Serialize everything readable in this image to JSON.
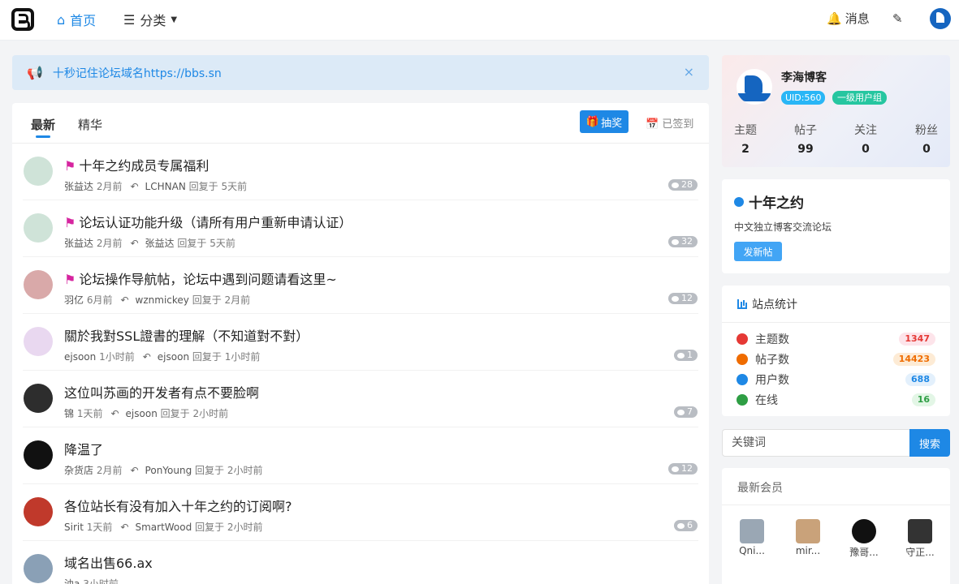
{
  "nav": {
    "home_label": "首页",
    "category_label": "分类",
    "messages_label": "消息"
  },
  "notice": {
    "text": "十秒记住论坛域名https://bbs.sn",
    "close": "×"
  },
  "tabs": {
    "latest": "最新",
    "featured": "精华",
    "lottery_button": "抽奖",
    "checkin_label": "已签到"
  },
  "posts": [
    {
      "flag": true,
      "title": "十年之约成员专属福利",
      "author": "张益达",
      "time": "2月前",
      "last_replier": "LCHNAN",
      "reply_time": "回复于 5天前",
      "count": "28"
    },
    {
      "flag": true,
      "title": "论坛认证功能升级（请所有用户重新申请认证）",
      "author": "张益达",
      "time": "2月前",
      "last_replier": "张益达",
      "reply_time": "回复于 5天前",
      "count": "32"
    },
    {
      "flag": true,
      "title": "论坛操作导航帖，论坛中遇到问题请看这里~",
      "author": "羽亿",
      "time": "6月前",
      "last_replier": "wznmickey",
      "reply_time": "回复于 2月前",
      "count": "12"
    },
    {
      "flag": false,
      "title": "關於我對SSL證書的理解（不知道對不對）",
      "author": "ejsoon",
      "time": "1小时前",
      "last_replier": "ejsoon",
      "reply_time": "回复于 1小时前",
      "count": "1"
    },
    {
      "flag": false,
      "title": "这位叫苏画的开发者有点不要脸啊",
      "author": "锦",
      "time": "1天前",
      "last_replier": "ejsoon",
      "reply_time": "回复于 2小时前",
      "count": "7"
    },
    {
      "flag": false,
      "title": "降温了",
      "author": "杂货店",
      "time": "2月前",
      "last_replier": "PonYoung",
      "reply_time": "回复于 2小时前",
      "count": "12"
    },
    {
      "flag": false,
      "title": "各位站长有没有加入十年之约的订阅啊?",
      "author": "Sirit",
      "time": "1天前",
      "last_replier": "SmartWood",
      "reply_time": "回复于 2小时前",
      "count": "6"
    },
    {
      "flag": false,
      "title": "域名出售66.ax",
      "author": "油a",
      "time": "3小时前",
      "last_replier": "",
      "reply_time": "",
      "count": ""
    }
  ],
  "profile": {
    "name": "李海博客",
    "uid": "UID:560",
    "group": "一级用户组",
    "stats": [
      {
        "label": "主题",
        "value": "2"
      },
      {
        "label": "帖子",
        "value": "99"
      },
      {
        "label": "关注",
        "value": "0"
      },
      {
        "label": "粉丝",
        "value": "0"
      }
    ]
  },
  "site": {
    "title": "十年之约",
    "description": "中文独立博客交流论坛",
    "new_post_button": "发新帖"
  },
  "site_stats": {
    "title": "站点统计",
    "rows": [
      {
        "label": "主题数",
        "value": "1347",
        "color": "#e53935",
        "bg": "#fde4ea",
        "icon": "chat-bubble-icon"
      },
      {
        "label": "帖子数",
        "value": "14423",
        "color": "#ef6c00",
        "bg": "#fdebd5",
        "icon": "chat-bubbles-icon"
      },
      {
        "label": "用户数",
        "value": "688",
        "color": "#1e88e5",
        "bg": "#e3f0fc",
        "icon": "users-icon"
      },
      {
        "label": "在线",
        "value": "16",
        "color": "#2e9e44",
        "bg": "#e3f6e6",
        "icon": "online-chat-icon"
      }
    ]
  },
  "search": {
    "placeholder": "关键词",
    "button": "搜索"
  },
  "members": {
    "title": "最新会员",
    "list": [
      "Qni...",
      "mir...",
      "豫哥...",
      "守正..."
    ]
  },
  "colors": {
    "accent": "#1e88e5",
    "flag": "#d6249f",
    "group_badge": "#26c6a0",
    "uid_badge": "#29b6f6"
  }
}
